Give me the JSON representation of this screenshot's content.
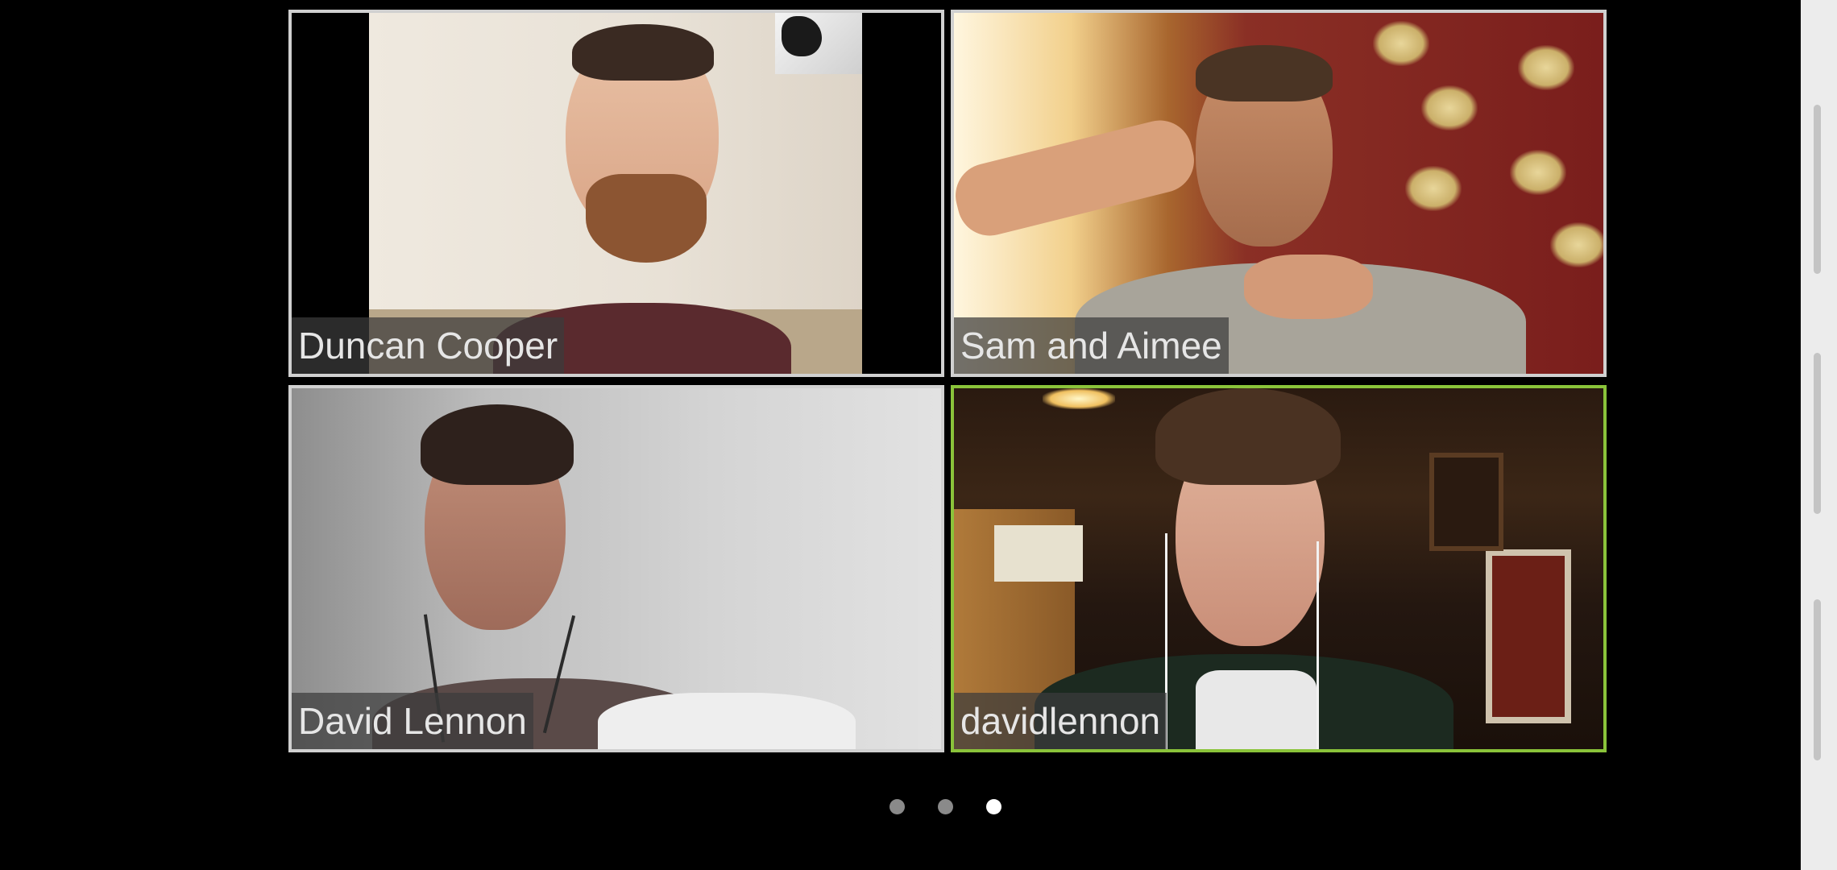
{
  "participants": [
    {
      "name": "Duncan Cooper",
      "active": false
    },
    {
      "name": "Sam and Aimee",
      "active": false
    },
    {
      "name": "David Lennon",
      "active": false
    },
    {
      "name": "davidlennon",
      "active": true
    }
  ],
  "pagination": {
    "total_pages": 3,
    "current_page": 3
  },
  "colors": {
    "active_speaker_border": "#8ac33a",
    "tile_border": "#d0d0d0",
    "background": "#000000",
    "name_tag_bg": "#3c3c3c"
  },
  "icons": [
    "page-dot-icon"
  ]
}
